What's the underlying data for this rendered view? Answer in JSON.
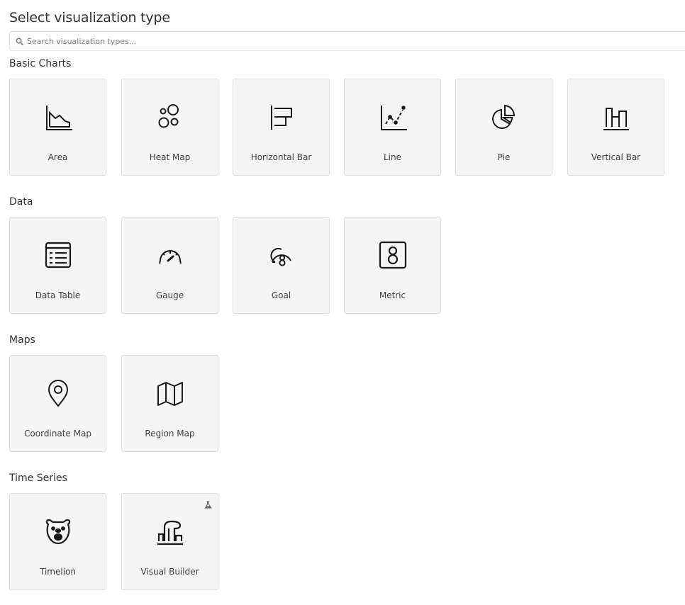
{
  "title": "Select visualization type",
  "search": {
    "placeholder": "Search visualization types...",
    "value": "",
    "icon": "search-icon"
  },
  "sections": [
    {
      "title": "Basic Charts",
      "items": [
        {
          "label": "Area",
          "icon": "area-chart-icon"
        },
        {
          "label": "Heat Map",
          "icon": "heat-map-icon"
        },
        {
          "label": "Horizontal Bar",
          "icon": "horizontal-bar-icon"
        },
        {
          "label": "Line",
          "icon": "line-chart-icon"
        },
        {
          "label": "Pie",
          "icon": "pie-chart-icon"
        },
        {
          "label": "Vertical Bar",
          "icon": "vertical-bar-icon"
        }
      ]
    },
    {
      "title": "Data",
      "items": [
        {
          "label": "Data Table",
          "icon": "data-table-icon"
        },
        {
          "label": "Gauge",
          "icon": "gauge-icon"
        },
        {
          "label": "Goal",
          "icon": "goal-icon"
        },
        {
          "label": "Metric",
          "icon": "metric-icon"
        }
      ]
    },
    {
      "title": "Maps",
      "items": [
        {
          "label": "Coordinate Map",
          "icon": "map-pin-icon"
        },
        {
          "label": "Region Map",
          "icon": "region-map-icon"
        }
      ]
    },
    {
      "title": "Time Series",
      "items": [
        {
          "label": "Timelion",
          "icon": "timelion-bear-icon"
        },
        {
          "label": "Visual Builder",
          "icon": "visual-builder-icon",
          "badge": "experimental-flask-icon"
        }
      ]
    }
  ],
  "colors": {
    "card_background": "#f5f5f5",
    "card_border": "#dcdfe3",
    "icon_stroke": "#1a1a1a",
    "text": "#333333",
    "badge": "#6a6a6a"
  }
}
